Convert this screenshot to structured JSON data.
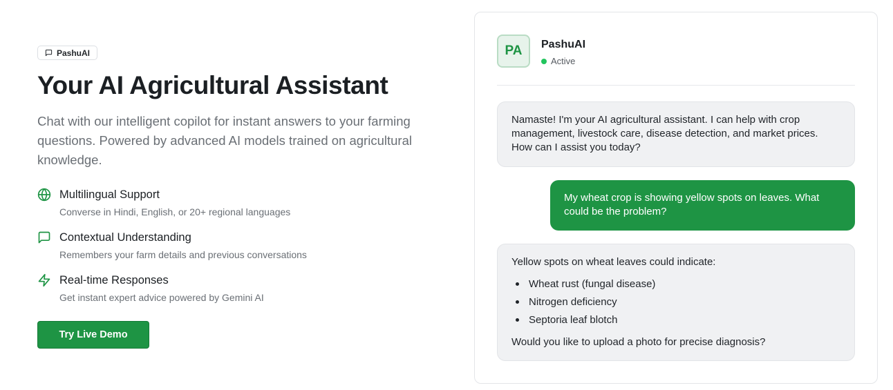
{
  "hero": {
    "badge": "PashuAI",
    "title": "Your AI Agricultural Assistant",
    "subtitle": "Chat with our intelligent copilot for instant answers to your farming questions. Powered by advanced AI models trained on agricultural knowledge."
  },
  "features": [
    {
      "icon": "globe-icon",
      "title": "Multilingual Support",
      "desc": "Converse in Hindi, English, or 20+ regional languages"
    },
    {
      "icon": "message-square-icon",
      "title": "Contextual Understanding",
      "desc": "Remembers your farm details and previous conversations"
    },
    {
      "icon": "lightning-icon",
      "title": "Real-time Responses",
      "desc": "Get instant expert advice powered by Gemini AI"
    }
  ],
  "cta": {
    "label": "Try Live Demo"
  },
  "chat": {
    "avatar": "PA",
    "name": "PashuAI",
    "status": "Active",
    "messages": {
      "bot1": "Namaste! I'm your AI agricultural assistant. I can help with crop management, livestock care, disease detection, and market prices. How can I assist you today?",
      "user1": "My wheat crop is showing yellow spots on leaves. What could be the problem?",
      "bot2_intro": "Yellow spots on wheat leaves could indicate:",
      "bot2_items": [
        "Wheat rust (fungal disease)",
        "Nitrogen deficiency",
        "Septoria leaf blotch"
      ],
      "bot2_follow": "Would you like to upload a photo for precise diagnosis?"
    }
  },
  "colors": {
    "accent": "#1e9444",
    "status": "#22c55e"
  }
}
